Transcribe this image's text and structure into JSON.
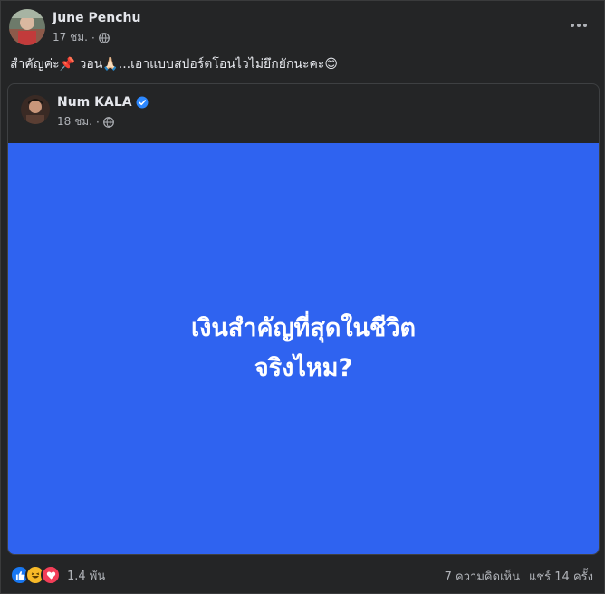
{
  "post": {
    "author": "June Penchu",
    "time": "17 ชม.",
    "separator": "·",
    "privacy_icon": "globe-icon",
    "text": "สำคัญค่ะ📌 วอน🙏🏻...เอาแบบสปอร์ตโอนไวไม่ยึกยักนะคะ😊",
    "more_icon": "more-horizontal-icon"
  },
  "shared": {
    "author": "Num KALA",
    "verified_icon": "verified-badge-icon",
    "time": "18 ชม.",
    "separator": "·",
    "privacy_icon": "globe-icon",
    "card_line1": "เงินสำคัญที่สุดในชีวิต",
    "card_line2": "จริงไหม?",
    "card_color": "#2f63f0"
  },
  "footer": {
    "reaction_icons": [
      "like-reaction-icon",
      "haha-reaction-icon",
      "love-reaction-icon"
    ],
    "reaction_count": "1.4 พัน",
    "comments": "7 ความคิดเห็น",
    "shares": "แชร์ 14 ครั้ง"
  },
  "colors": {
    "background": "#242526",
    "text_primary": "#e4e6eb",
    "text_secondary": "#b0b3b8",
    "verified": "#2d88ff",
    "like": "#1877f2",
    "love": "#f33e58",
    "haha": "#f7b928"
  }
}
